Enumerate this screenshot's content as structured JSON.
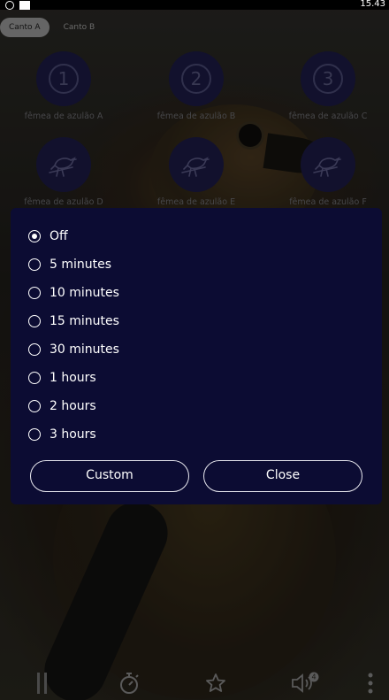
{
  "status_bar": {
    "time": "15.43"
  },
  "tabs": [
    {
      "label": "Canto A",
      "active": true
    },
    {
      "label": "Canto B",
      "active": false
    }
  ],
  "sounds": [
    {
      "label": "fêmea de azulão A",
      "icon": "number-1-icon",
      "number": "1"
    },
    {
      "label": "fêmea de azulão B",
      "icon": "number-2-icon",
      "number": "2"
    },
    {
      "label": "fêmea de azulão C",
      "icon": "number-3-icon",
      "number": "3"
    },
    {
      "label": "fêmea de azulão D",
      "icon": "bird-icon"
    },
    {
      "label": "fêmea de azulão E",
      "icon": "bird-icon"
    },
    {
      "label": "fêmea de azulão F",
      "icon": "bird-icon"
    }
  ],
  "timer_dialog": {
    "options": [
      {
        "label": "Off",
        "selected": true
      },
      {
        "label": "5 minutes",
        "selected": false
      },
      {
        "label": "10 minutes",
        "selected": false
      },
      {
        "label": "15 minutes",
        "selected": false
      },
      {
        "label": "30 minutes",
        "selected": false
      },
      {
        "label": "1 hours",
        "selected": false
      },
      {
        "label": "2 hours",
        "selected": false
      },
      {
        "label": "3 hours",
        "selected": false
      }
    ],
    "custom_label": "Custom",
    "close_label": "Close"
  },
  "bottom_bar": {
    "volume_badge": "4",
    "icons": [
      "pause-icon",
      "timer-icon",
      "star-icon",
      "volume-icon",
      "more-vertical-icon"
    ]
  },
  "colors": {
    "dialog_bg": "#0c0c33",
    "circle_bg": "#1c1b45",
    "tab_active_bg": "#9b9b9b"
  }
}
